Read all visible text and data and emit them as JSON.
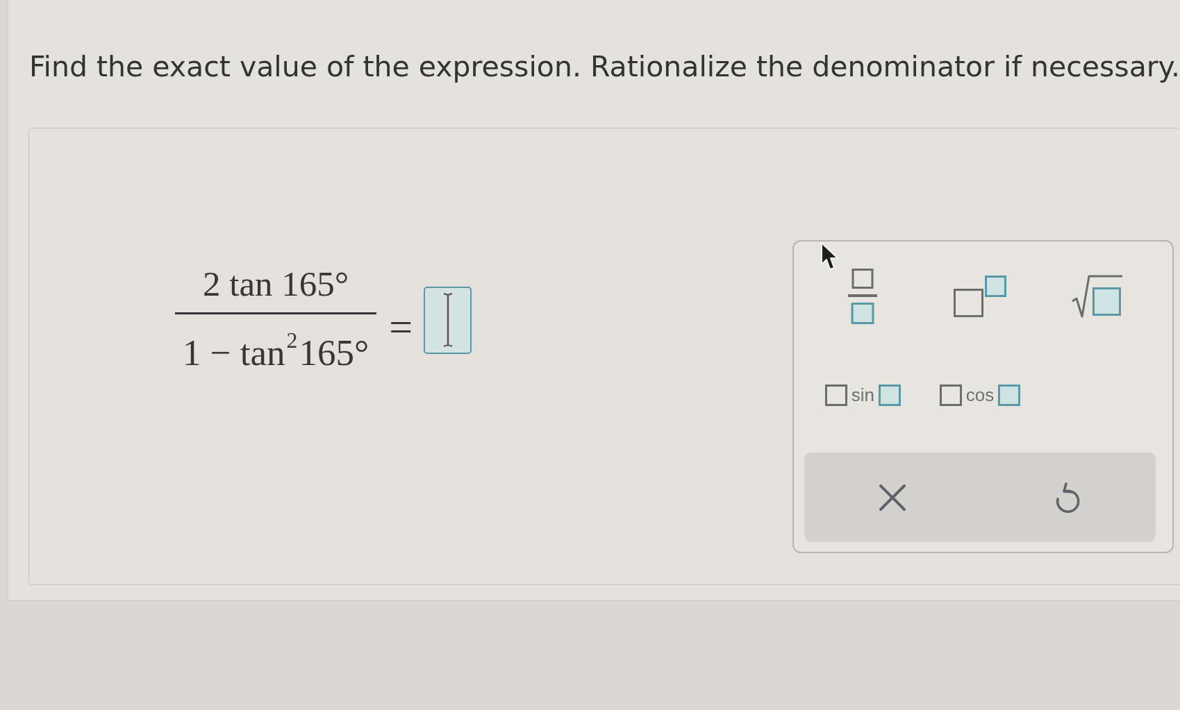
{
  "question": {
    "prompt": "Find the exact value of the expression. Rationalize the denominator if necessary."
  },
  "answer_area": {
    "expression": {
      "numerator": "2 tan 165°",
      "denominator": "1 − tan$^{2}$165°"
    },
    "equals": "=",
    "answer_field": {
      "focused": true
    },
    "palette": {
      "templates": [
        {
          "kind": "fraction"
        },
        {
          "kind": "power"
        },
        {
          "kind": "square_root"
        },
        {
          "kind": "function",
          "label": "sin"
        },
        {
          "kind": "function",
          "label": "cos"
        }
      ],
      "actions": [
        {
          "kind": "clear"
        },
        {
          "kind": "undo"
        }
      ]
    }
  }
}
